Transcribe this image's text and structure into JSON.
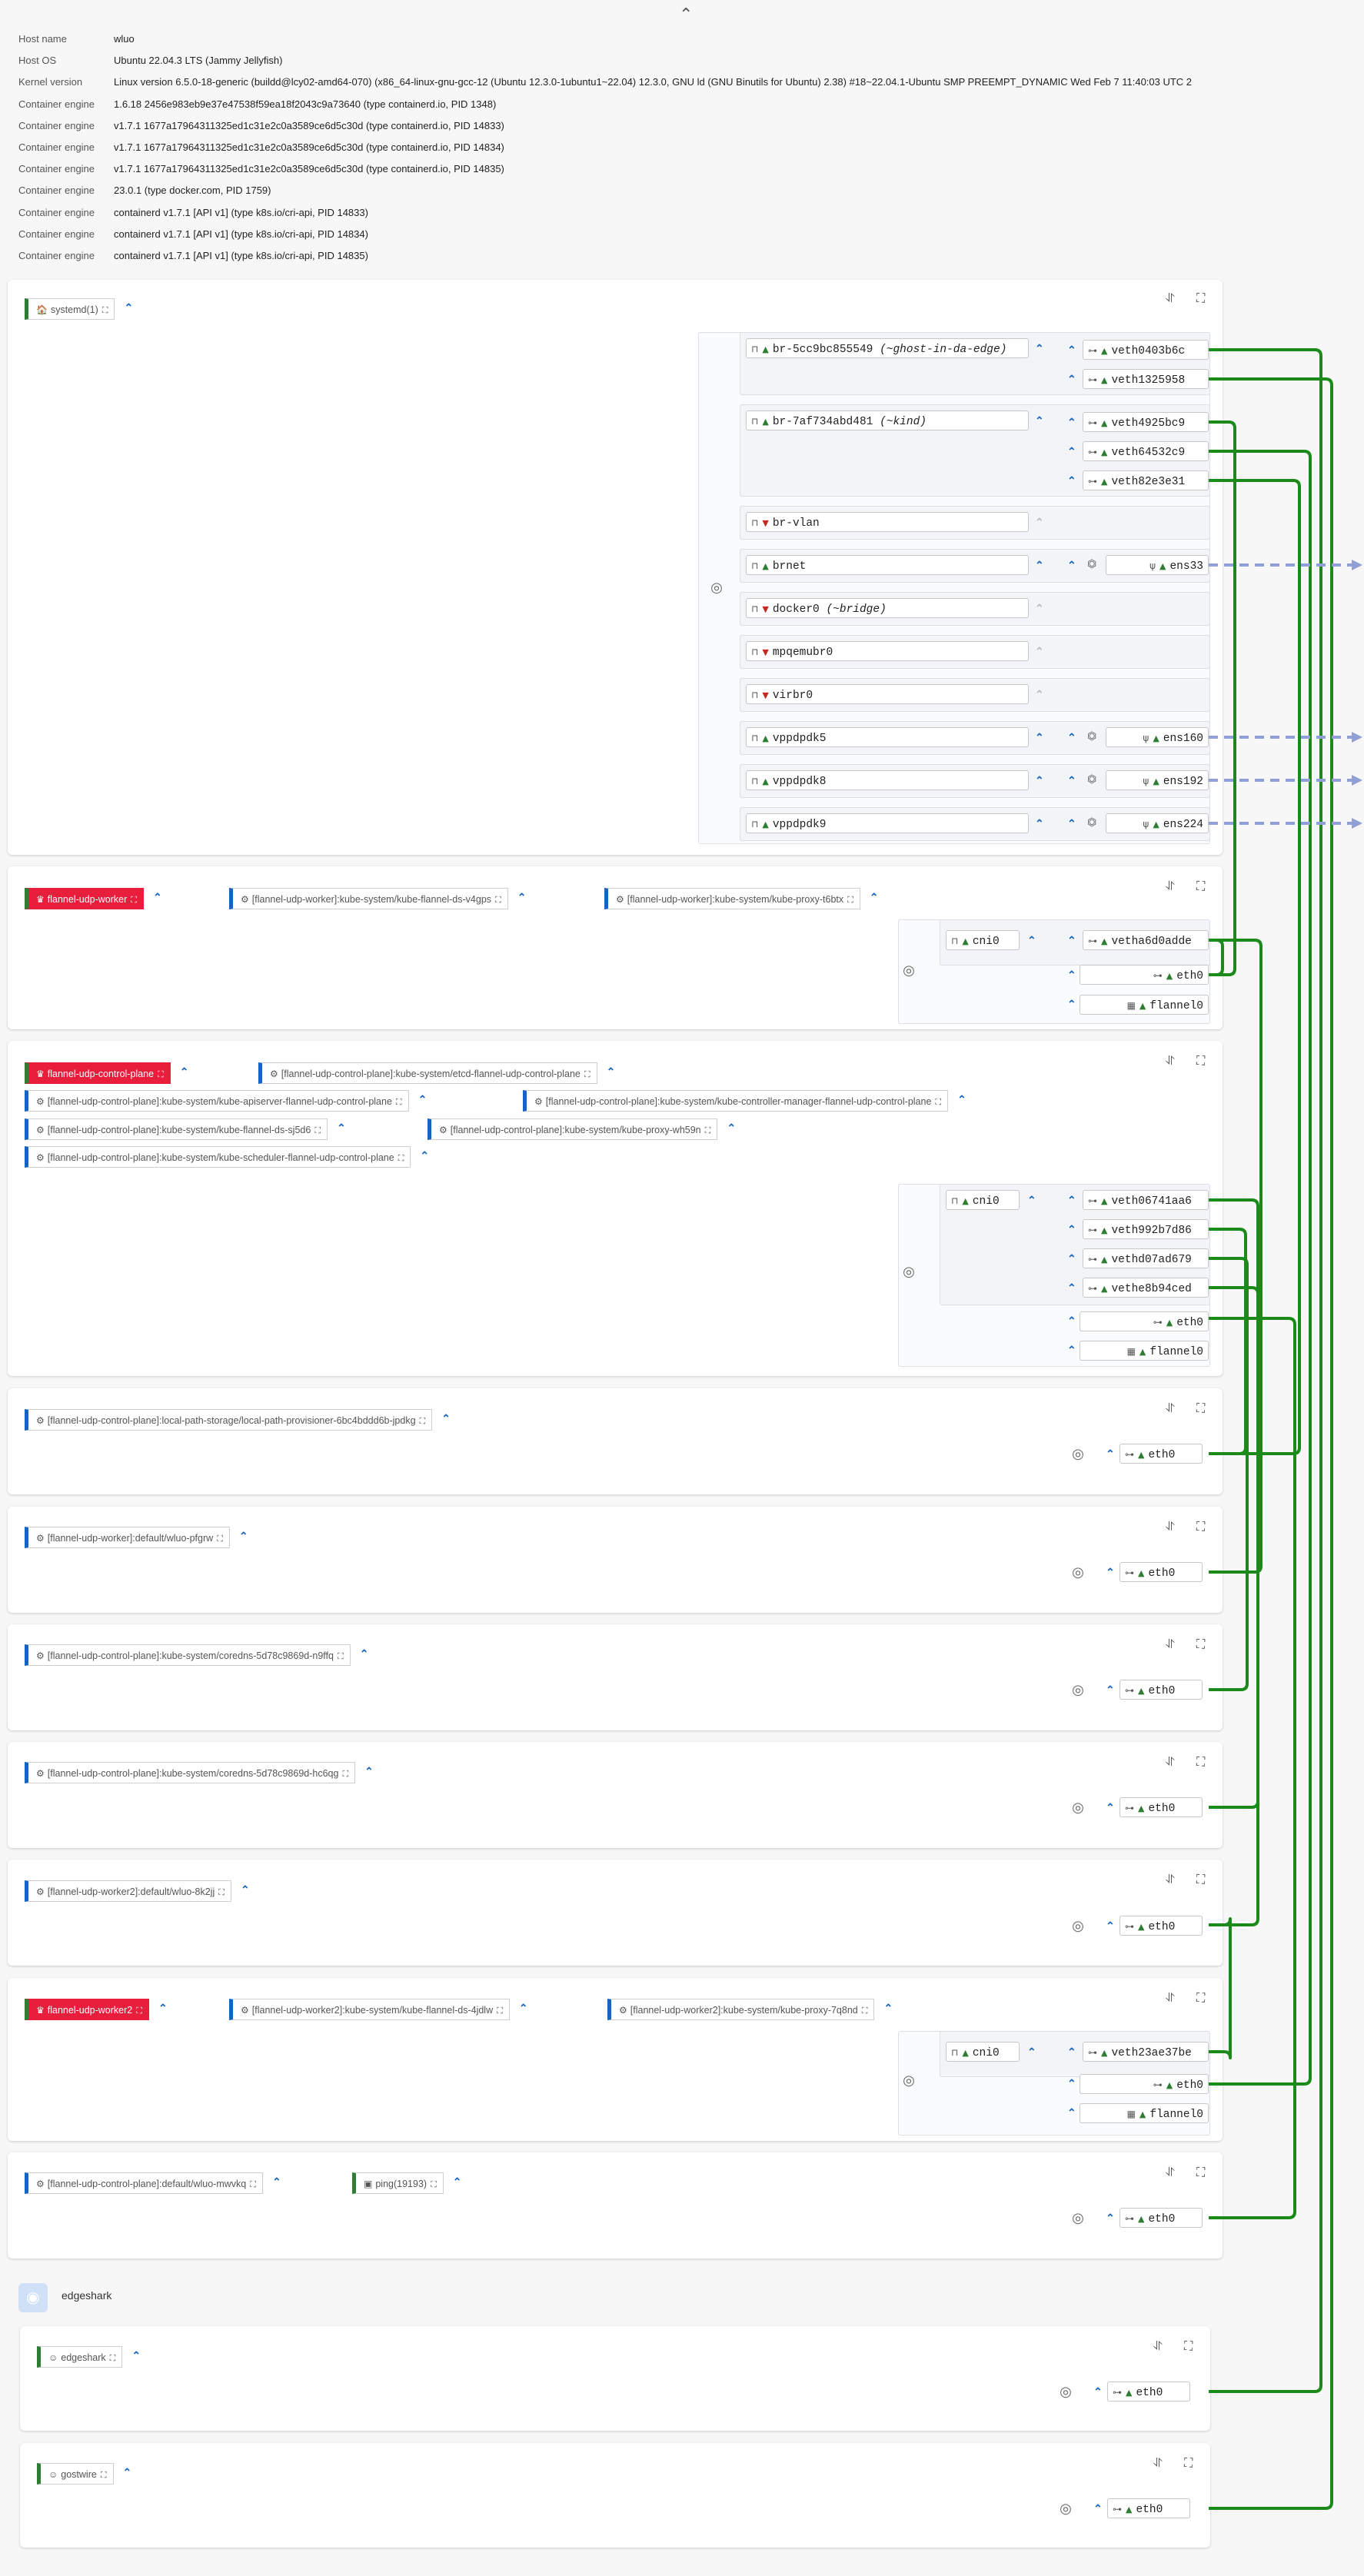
{
  "header": {
    "collapse_icon": "chevron-up-icon",
    "host_info": [
      {
        "key": "Host name",
        "value": "wluo"
      },
      {
        "key": "Host OS",
        "value": "Ubuntu 22.04.3 LTS (Jammy Jellyfish)"
      },
      {
        "key": "Kernel version",
        "value": "Linux version 6.5.0-18-generic (buildd@lcy02-amd64-070) (x86_64-linux-gnu-gcc-12 (Ubuntu 12.3.0-1ubuntu1~22.04) 12.3.0, GNU ld (GNU Binutils for Ubuntu) 2.38) #18~22.04.1-Ubuntu SMP PREEMPT_DYNAMIC Wed Feb 7 11:40:03 UTC 2"
      },
      {
        "key": "Container engine",
        "value": "1.6.18 2456e983eb9e37e47538f59ea18f2043c9a73640 (type containerd.io, PID 1348)"
      },
      {
        "key": "Container engine",
        "value": "v1.7.1 1677a17964311325ed1c31e2c0a3589ce6d5c30d (type containerd.io, PID 14833)"
      },
      {
        "key": "Container engine",
        "value": "v1.7.1 1677a17964311325ed1c31e2c0a3589ce6d5c30d (type containerd.io, PID 14834)"
      },
      {
        "key": "Container engine",
        "value": "v1.7.1 1677a17964311325ed1c31e2c0a3589ce6d5c30d (type containerd.io, PID 14835)"
      },
      {
        "key": "Container engine",
        "value": "23.0.1 (type docker.com, PID 1759)"
      },
      {
        "key": "Container engine",
        "value": "containerd v1.7.1 [API v1] (type k8s.io/cri-api, PID 14833)"
      },
      {
        "key": "Container engine",
        "value": "containerd v1.7.1 [API v1] (type k8s.io/cri-api, PID 14834)"
      },
      {
        "key": "Container engine",
        "value": "containerd v1.7.1 [API v1] (type k8s.io/cri-api, PID 14835)"
      }
    ]
  },
  "icons": {
    "up": "⌃",
    "capture": "wireshark-fin-icon",
    "fullscreen": "fullscreen-icon",
    "target": "target-icon"
  },
  "colors": {
    "link": "#1b8a1b",
    "external": "#8ea0d6",
    "accent_red": "#e91e3d",
    "accent_green": "#2e7d32",
    "accent_blue": "#1565c0"
  },
  "chips": [
    {
      "label": "systemd(1)"
    },
    {
      "label": "flannel-udp-worker"
    },
    {
      "label": "[flannel-udp-worker]:kube-system/kube-flannel-ds-v4gps"
    },
    {
      "label": "[flannel-udp-worker]:kube-system/kube-proxy-t6btx"
    },
    {
      "label": "flannel-udp-control-plane"
    },
    {
      "label": "[flannel-udp-control-plane]:kube-system/etcd-flannel-udp-control-plane"
    },
    {
      "label": "[flannel-udp-control-plane]:kube-system/kube-apiserver-flannel-udp-control-plane"
    },
    {
      "label": "[flannel-udp-control-plane]:kube-system/kube-controller-manager-flannel-udp-control-plane"
    },
    {
      "label": "[flannel-udp-control-plane]:kube-system/kube-flannel-ds-sj5d6"
    },
    {
      "label": "[flannel-udp-control-plane]:kube-system/kube-proxy-wh59n"
    },
    {
      "label": "[flannel-udp-control-plane]:kube-system/kube-scheduler-flannel-udp-control-plane"
    },
    {
      "label": "[flannel-udp-control-plane]:local-path-storage/local-path-provisioner-6bc4bddd6b-jpdkg"
    },
    {
      "label": "[flannel-udp-worker]:default/wluo-pfgrw"
    },
    {
      "label": "[flannel-udp-control-plane]:kube-system/coredns-5d78c9869d-n9ffq"
    },
    {
      "label": "[flannel-udp-control-plane]:kube-system/coredns-5d78c9869d-hc6qg"
    },
    {
      "label": "[flannel-udp-worker2]:default/wluo-8k2jj"
    },
    {
      "label": "flannel-udp-worker2"
    },
    {
      "label": "[flannel-udp-worker2]:kube-system/kube-flannel-ds-4jdlw"
    },
    {
      "label": "[flannel-udp-worker2]:kube-system/kube-proxy-7q8nd"
    },
    {
      "label": "[flannel-udp-control-plane]:default/wluo-mwvkq"
    },
    {
      "label": "ping(19193)"
    },
    {
      "label": "edgeshark"
    },
    {
      "label": "gostwire"
    }
  ],
  "section": {
    "edgeshark_title": "edgeshark"
  },
  "bridges": [
    {
      "name": "br-5cc9bc855549",
      "alias": "(~ghost-in-da-edge)"
    },
    {
      "name": "br-7af734abd481",
      "alias": "(~kind)"
    },
    {
      "name": "br-vlan",
      "alias": ""
    },
    {
      "name": "brnet",
      "alias": ""
    },
    {
      "name": "docker0",
      "alias": "(~bridge)"
    },
    {
      "name": "mpqemubr0",
      "alias": ""
    },
    {
      "name": "virbr0",
      "alias": ""
    },
    {
      "name": "vppdpdk5",
      "alias": ""
    },
    {
      "name": "vppdpdk8",
      "alias": ""
    },
    {
      "name": "vppdpdk9",
      "alias": ""
    },
    {
      "name": "cni0",
      "alias": ""
    }
  ],
  "ifaces": [
    "veth0403b6c",
    "veth1325958",
    "veth4925bc9",
    "veth64532c9",
    "veth82e3e31",
    "ens33",
    "ens160",
    "ens192",
    "ens224",
    "vetha6d0adde",
    "eth0",
    "flannel0",
    "veth06741aa6",
    "veth992b7d86",
    "vethd07ad679",
    "vethe8b94ced",
    "veth23ae37be"
  ]
}
